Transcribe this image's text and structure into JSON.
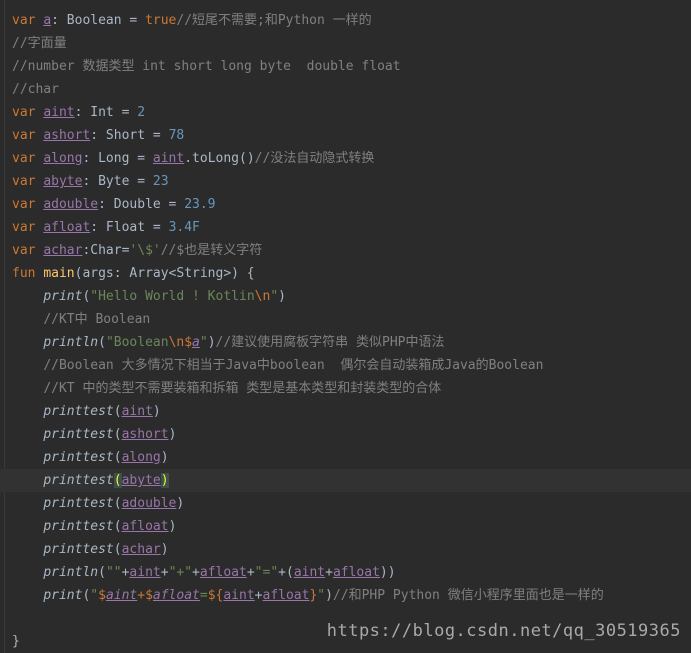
{
  "editor": {
    "top_fragment": "*/",
    "lines": [
      {
        "id": "line-1",
        "text_parts": [
          [
            "kw",
            "var "
          ],
          [
            "prop",
            "a"
          ],
          [
            "plain",
            ": Boolean = "
          ],
          [
            "kw",
            "true"
          ],
          [
            "cm",
            "//短尾不需要;和Python 一样的"
          ]
        ]
      },
      {
        "id": "line-2",
        "text_parts": [
          [
            "cm",
            "//字面量"
          ]
        ]
      },
      {
        "id": "line-3",
        "text_parts": [
          [
            "cm",
            "//number 数据类型 int short long byte  double float"
          ]
        ]
      },
      {
        "id": "line-4",
        "text_parts": [
          [
            "cm",
            "//char"
          ]
        ]
      },
      {
        "id": "line-5",
        "text_parts": [
          [
            "kw",
            "var "
          ],
          [
            "prop",
            "aint"
          ],
          [
            "plain",
            ": Int = "
          ],
          [
            "num",
            "2"
          ]
        ]
      },
      {
        "id": "line-6",
        "text_parts": [
          [
            "kw",
            "var "
          ],
          [
            "prop",
            "ashort"
          ],
          [
            "plain",
            ": Short = "
          ],
          [
            "num",
            "78"
          ]
        ]
      },
      {
        "id": "line-7",
        "text_parts": [
          [
            "kw",
            "var "
          ],
          [
            "prop",
            "along"
          ],
          [
            "plain",
            ": Long = "
          ],
          [
            "prop",
            "aint"
          ],
          [
            "plain",
            ".toLong()"
          ],
          [
            "cm",
            "//没法自动隐式转换"
          ]
        ]
      },
      {
        "id": "line-8",
        "text_parts": [
          [
            "kw",
            "var "
          ],
          [
            "prop",
            "abyte"
          ],
          [
            "plain",
            ": Byte = "
          ],
          [
            "num",
            "23"
          ]
        ]
      },
      {
        "id": "line-9",
        "text_parts": [
          [
            "kw",
            "var "
          ],
          [
            "prop",
            "adouble"
          ],
          [
            "plain",
            ": Double = "
          ],
          [
            "num",
            "23.9"
          ]
        ]
      },
      {
        "id": "line-10",
        "text_parts": [
          [
            "kw",
            "var "
          ],
          [
            "prop",
            "afloat"
          ],
          [
            "plain",
            ": Float = "
          ],
          [
            "num",
            "3.4F"
          ]
        ]
      },
      {
        "id": "line-11",
        "text_parts": [
          [
            "kw",
            "var "
          ],
          [
            "prop",
            "achar"
          ],
          [
            "plain",
            ":Char="
          ],
          [
            "str",
            "'\\$'"
          ],
          [
            "cm",
            "//$也是转义字符"
          ]
        ]
      },
      {
        "id": "line-12",
        "text_parts": [
          [
            "kw",
            "fun "
          ],
          [
            "fn",
            "main"
          ],
          [
            "plain",
            "(args: Array<String>) {"
          ]
        ]
      },
      {
        "id": "line-13",
        "text_parts": [
          [
            "indent",
            "    "
          ],
          [
            "ital",
            "print"
          ],
          [
            "plain",
            "("
          ],
          [
            "str",
            "\"Hello World ! Kotlin"
          ],
          [
            "esc",
            "\\n"
          ],
          [
            "str",
            "\""
          ],
          [
            "plain",
            ")"
          ]
        ]
      },
      {
        "id": "line-14",
        "text_parts": [
          [
            "indent",
            "    "
          ],
          [
            "cm",
            "//KT中 Boolean"
          ]
        ]
      },
      {
        "id": "line-15",
        "text_parts": [
          [
            "indent",
            "    "
          ],
          [
            "ital",
            "println"
          ],
          [
            "plain",
            "("
          ],
          [
            "str",
            "\"Boolean"
          ],
          [
            "esc",
            "\\n$"
          ],
          [
            "prop-ital",
            "a"
          ],
          [
            "str",
            "\""
          ],
          [
            "plain",
            ")"
          ],
          [
            "cm",
            "//建议使用腐板字符串 类似PHP中语法"
          ]
        ]
      },
      {
        "id": "line-16",
        "text_parts": [
          [
            "indent",
            "    "
          ],
          [
            "cm",
            "//Boolean 大多情况下相当于Java中boolean  偶尔会自动装箱成Java的Boolean"
          ]
        ]
      },
      {
        "id": "line-17",
        "text_parts": [
          [
            "indent",
            "    "
          ],
          [
            "cm",
            "//KT 中的类型不需要装箱和拆箱 类型是基本类型和封装类型的合体"
          ]
        ]
      },
      {
        "id": "line-18",
        "text_parts": [
          [
            "indent",
            "    "
          ],
          [
            "ital",
            "printtest"
          ],
          [
            "plain",
            "("
          ],
          [
            "prop",
            "aint"
          ],
          [
            "plain",
            ")"
          ]
        ]
      },
      {
        "id": "line-19",
        "text_parts": [
          [
            "indent",
            "    "
          ],
          [
            "ital",
            "printtest"
          ],
          [
            "plain",
            "("
          ],
          [
            "prop",
            "ashort"
          ],
          [
            "plain",
            ")"
          ]
        ]
      },
      {
        "id": "line-20",
        "text_parts": [
          [
            "indent",
            "    "
          ],
          [
            "ital",
            "printtest"
          ],
          [
            "plain",
            "("
          ],
          [
            "prop",
            "along"
          ],
          [
            "plain",
            ")"
          ]
        ]
      },
      {
        "id": "line-21",
        "current": true,
        "text_parts": [
          [
            "indent",
            "    "
          ],
          [
            "ital",
            "printtest"
          ],
          [
            "hl",
            "("
          ],
          [
            "prop",
            "abyte"
          ],
          [
            "hl",
            ")"
          ]
        ]
      },
      {
        "id": "line-22",
        "text_parts": [
          [
            "indent",
            "    "
          ],
          [
            "ital",
            "printtest"
          ],
          [
            "plain",
            "("
          ],
          [
            "prop",
            "adouble"
          ],
          [
            "plain",
            ")"
          ]
        ]
      },
      {
        "id": "line-23",
        "text_parts": [
          [
            "indent",
            "    "
          ],
          [
            "ital",
            "printtest"
          ],
          [
            "plain",
            "("
          ],
          [
            "prop",
            "afloat"
          ],
          [
            "plain",
            ")"
          ]
        ]
      },
      {
        "id": "line-24",
        "text_parts": [
          [
            "indent",
            "    "
          ],
          [
            "ital",
            "printtest"
          ],
          [
            "plain",
            "("
          ],
          [
            "prop",
            "achar"
          ],
          [
            "plain",
            ")"
          ]
        ]
      },
      {
        "id": "line-25",
        "text_parts": [
          [
            "indent",
            "    "
          ],
          [
            "ital",
            "println"
          ],
          [
            "plain",
            "("
          ],
          [
            "str",
            "\"\""
          ],
          [
            "plain",
            "+"
          ],
          [
            "prop",
            "aint"
          ],
          [
            "plain",
            "+"
          ],
          [
            "str",
            "\"+\""
          ],
          [
            "plain",
            "+"
          ],
          [
            "prop",
            "afloat"
          ],
          [
            "plain",
            "+"
          ],
          [
            "str",
            "\"=\""
          ],
          [
            "plain",
            "+("
          ],
          [
            "prop",
            "aint"
          ],
          [
            "plain",
            "+"
          ],
          [
            "prop",
            "afloat"
          ],
          [
            "plain",
            "))"
          ]
        ]
      },
      {
        "id": "line-26",
        "text_parts": [
          [
            "indent",
            "    "
          ],
          [
            "ital",
            "print"
          ],
          [
            "plain",
            "("
          ],
          [
            "str",
            "\""
          ],
          [
            "esc",
            "$"
          ],
          [
            "prop-ital",
            "aint"
          ],
          [
            "esc",
            "+$"
          ],
          [
            "prop-ital",
            "afloat"
          ],
          [
            "str",
            "="
          ],
          [
            "esc",
            "${"
          ],
          [
            "prop",
            "aint"
          ],
          [
            "plain",
            "+"
          ],
          [
            "prop",
            "afloat"
          ],
          [
            "esc",
            "}"
          ],
          [
            "str",
            "\""
          ],
          [
            "plain",
            ")"
          ],
          [
            "cm",
            "//和PHP Python 微信小程序里面也是一样的"
          ]
        ]
      },
      {
        "id": "line-27",
        "text_parts": [
          [
            "plain",
            ""
          ]
        ]
      },
      {
        "id": "line-28",
        "text_parts": [
          [
            "plain",
            "}"
          ]
        ]
      }
    ]
  },
  "watermark": "https://blog.csdn.net/qq_30519365"
}
